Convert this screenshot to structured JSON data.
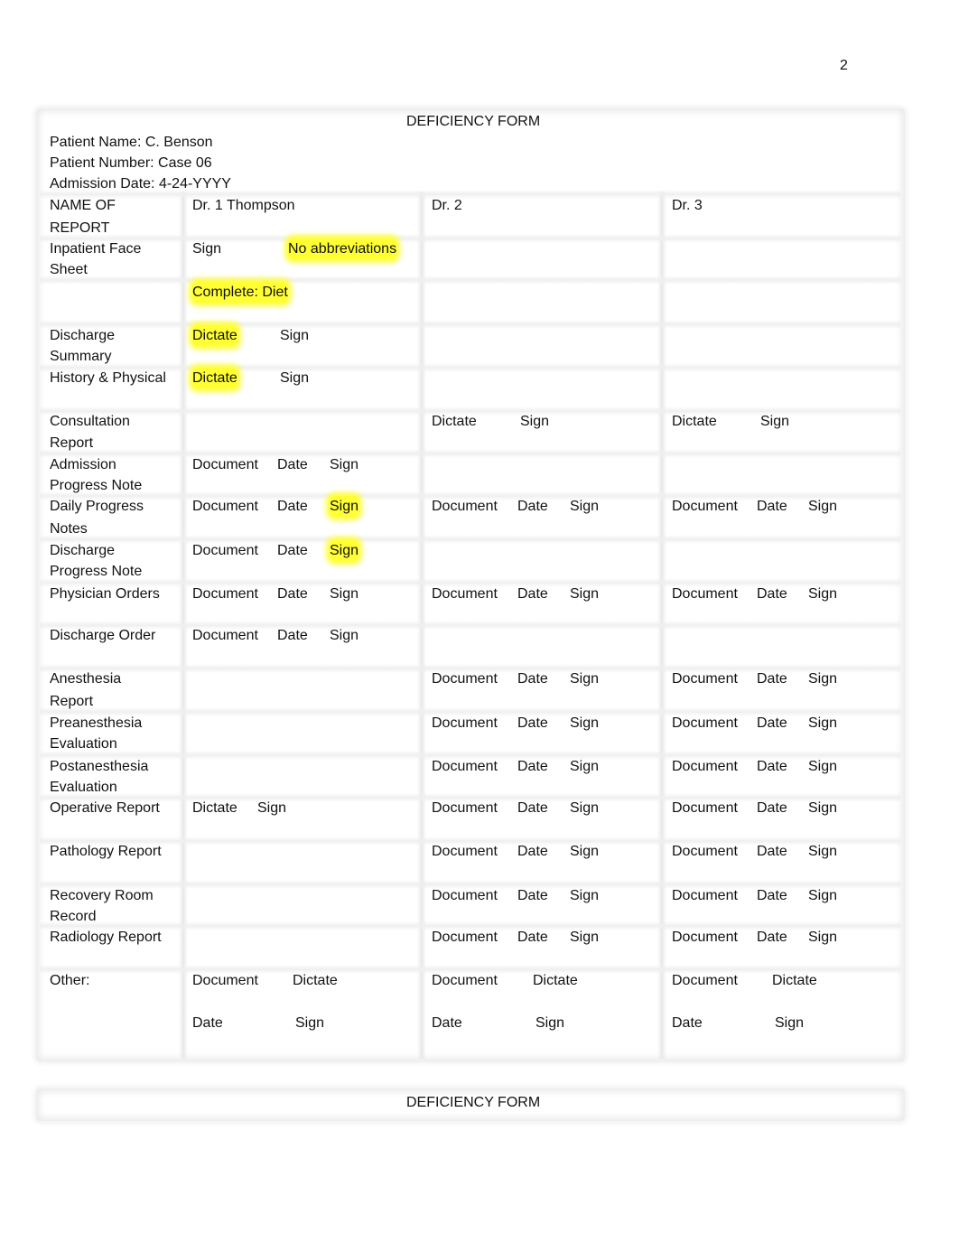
{
  "page_number": "2",
  "form_title": "DEFICIENCY FORM",
  "patient": {
    "name": "Patient Name: C. Benson",
    "number": "Patient Number: Case 06",
    "admission_date": "Admission Date: 4-24-YYYY"
  },
  "header": {
    "col_report_line1": "NAME OF",
    "col_report_line2": "REPORT",
    "dr1": "Dr. 1 Thompson",
    "dr2": "Dr. 2",
    "dr3": "Dr. 3"
  },
  "highlight_color": "#ffff33",
  "rows": {
    "face_sheet": {
      "l1": "Inpatient Face",
      "l2": "Sheet",
      "dr1_a": "Sign",
      "dr1_b": "No abbreviations",
      "dr1_c": "Complete: Diet"
    },
    "discharge_summary": {
      "l1": "Discharge",
      "l2": "Summary",
      "dr1_a": "Dictate",
      "dr1_b": "Sign"
    },
    "history_physical": {
      "l1": "History & Physical",
      "dr1_a": "Dictate",
      "dr1_b": "Sign"
    },
    "consultation": {
      "l1": "Consultation",
      "l2": "Report",
      "dr2_a": "Dictate",
      "dr2_b": "Sign",
      "dr3_a": "Dictate",
      "dr3_b": "Sign"
    },
    "admission_progress": {
      "l1": "Admission",
      "l2": "Progress Note",
      "dr1": [
        "Document",
        "Date",
        "Sign"
      ]
    },
    "daily_progress": {
      "l1": "Daily Progress",
      "l2": "Notes",
      "dr1": [
        "Document",
        "Date",
        "Sign"
      ],
      "dr2": [
        "Document",
        "Date",
        "Sign"
      ],
      "dr3": [
        "Document",
        "Date",
        "Sign"
      ]
    },
    "discharge_progress": {
      "l1": "Discharge",
      "l2": "Progress Note",
      "dr1": [
        "Document",
        "Date",
        "Sign"
      ]
    },
    "physician_orders": {
      "l1": "Physician Orders",
      "dr1": [
        "Document",
        "Date",
        "Sign"
      ],
      "dr2": [
        "Document",
        "Date",
        "Sign"
      ],
      "dr3": [
        "Document",
        "Date",
        "Sign"
      ]
    },
    "discharge_order": {
      "l1": "Discharge Order",
      "dr1": [
        "Document",
        "Date",
        "Sign"
      ]
    },
    "anesthesia": {
      "l1": "Anesthesia",
      "l2": "Report",
      "dr2": [
        "Document",
        "Date",
        "Sign"
      ],
      "dr3": [
        "Document",
        "Date",
        "Sign"
      ]
    },
    "preanesthesia": {
      "l1": "Preanesthesia",
      "l2": "Evaluation",
      "dr2": [
        "Document",
        "Date",
        "Sign"
      ],
      "dr3": [
        "Document",
        "Date",
        "Sign"
      ]
    },
    "postanesthesia": {
      "l1": "Postanesthesia",
      "l2": "Evaluation",
      "dr2": [
        "Document",
        "Date",
        "Sign"
      ],
      "dr3": [
        "Document",
        "Date",
        "Sign"
      ]
    },
    "operative": {
      "l1": "Operative Report",
      "dr1_a": "Dictate",
      "dr1_b": "Sign",
      "dr2": [
        "Document",
        "Date",
        "Sign"
      ],
      "dr3": [
        "Document",
        "Date",
        "Sign"
      ]
    },
    "pathology": {
      "l1": "Pathology Report",
      "dr2": [
        "Document",
        "Date",
        "Sign"
      ],
      "dr3": [
        "Document",
        "Date",
        "Sign"
      ]
    },
    "recovery": {
      "l1": "Recovery Room",
      "l2": "Record",
      "dr2": [
        "Document",
        "Date",
        "Sign"
      ],
      "dr3": [
        "Document",
        "Date",
        "Sign"
      ]
    },
    "radiology": {
      "l1": "Radiology Report",
      "dr2": [
        "Document",
        "Date",
        "Sign"
      ],
      "dr3": [
        "Document",
        "Date",
        "Sign"
      ]
    },
    "other": {
      "l1": "Other:",
      "cells": [
        "Document",
        "Dictate",
        "Date",
        "Sign"
      ]
    }
  }
}
